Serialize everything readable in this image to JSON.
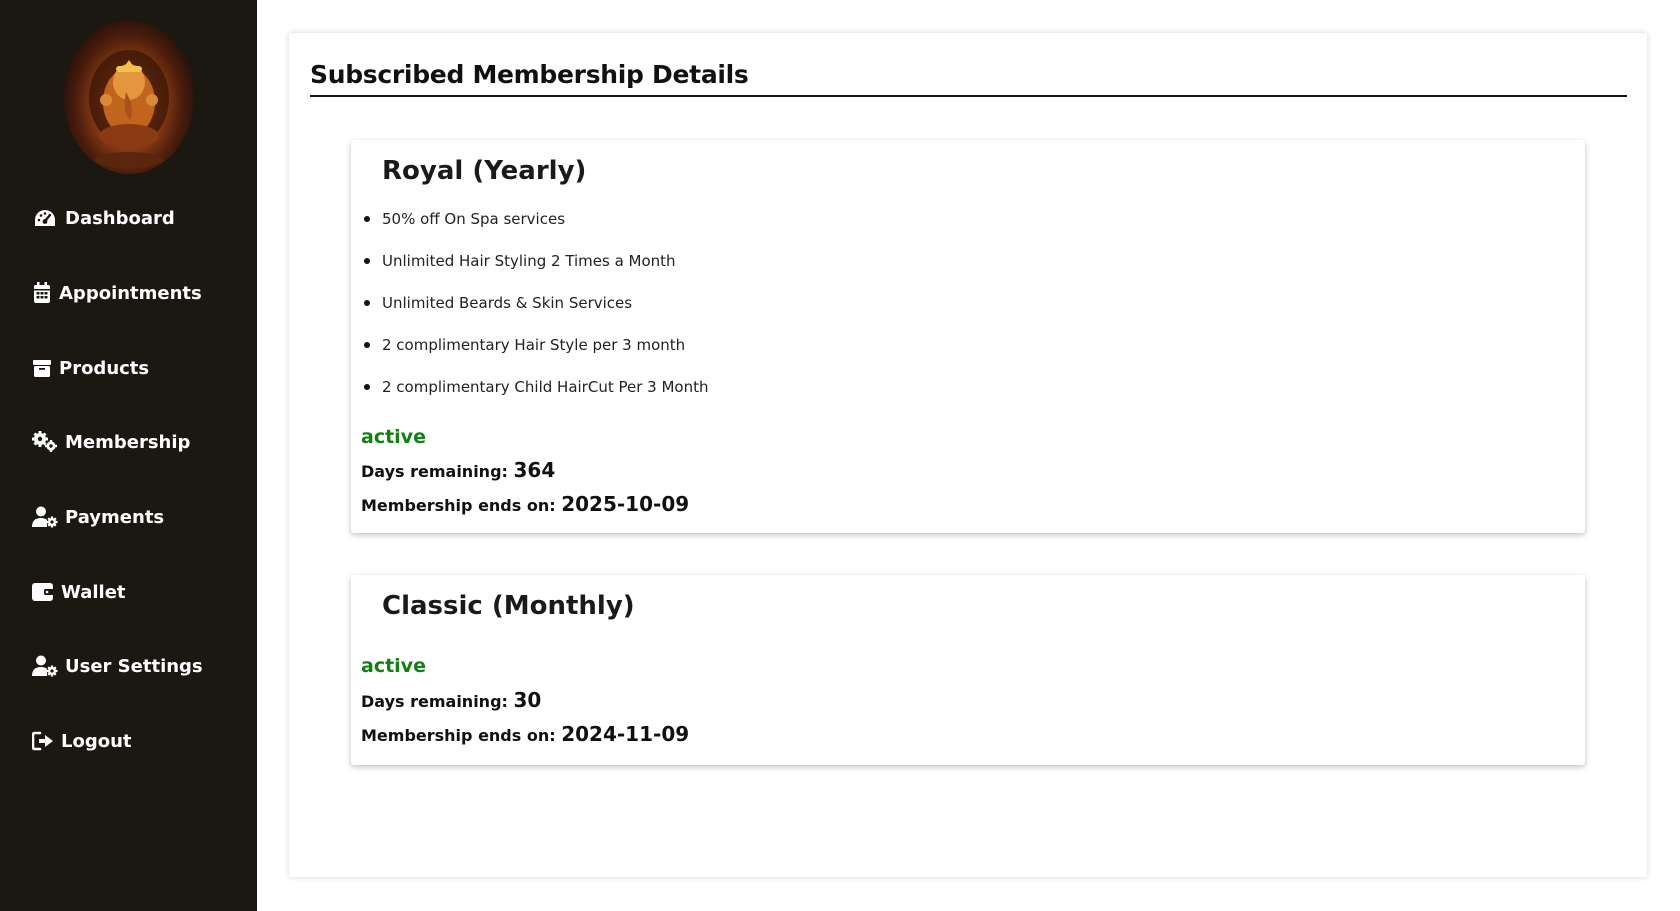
{
  "sidebar": {
    "logo_alt": "Ganesha logo",
    "items": [
      {
        "label": "Dashboard",
        "icon": "dashboard-gauge-icon"
      },
      {
        "label": "Appointments",
        "icon": "calendar-icon"
      },
      {
        "label": "Products",
        "icon": "box-icon"
      },
      {
        "label": "Membership",
        "icon": "gears-icon"
      },
      {
        "label": "Payments",
        "icon": "user-gear-icon"
      },
      {
        "label": "Wallet",
        "icon": "wallet-icon"
      },
      {
        "label": "User Settings",
        "icon": "user-gear-icon"
      },
      {
        "label": "Logout",
        "icon": "logout-icon"
      }
    ]
  },
  "main": {
    "title": "Subscribed Membership Details",
    "memberships": [
      {
        "name": "Royal (Yearly)",
        "benefits": [
          "50% off On Spa services",
          "Unlimited Hair Styling 2 Times a Month",
          "Unlimited Beards & Skin Services",
          "2 complimentary Hair Style per 3 month",
          "2 complimentary Child HairCut Per 3 Month"
        ],
        "status": "active",
        "days_label": "Days remaining:",
        "days_value": "364",
        "ends_label": "Membership ends on:",
        "ends_value": "2025-10-09"
      },
      {
        "name": "Classic (Monthly)",
        "benefits": [],
        "status": "active",
        "days_label": "Days remaining:",
        "days_value": "30",
        "ends_label": "Membership ends on:",
        "ends_value": "2024-11-09"
      }
    ]
  },
  "colors": {
    "sidebar_bg": "#1b1711",
    "status_active": "#128012",
    "text": "#111111"
  }
}
